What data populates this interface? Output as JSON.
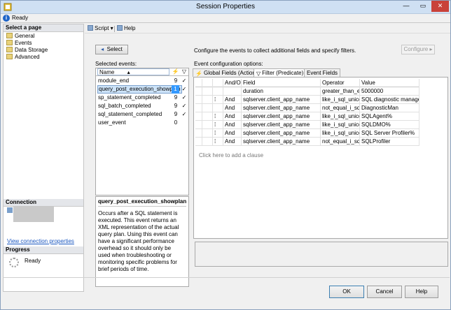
{
  "window": {
    "title": "Session Properties",
    "minimize": "—",
    "maximize": "▭",
    "close": "✕"
  },
  "status_bar": {
    "text": "Ready"
  },
  "left_pane": {
    "select_page_header": "Select a page",
    "pages": [
      "General",
      "Events",
      "Data Storage",
      "Advanced"
    ],
    "connection_header": "Connection",
    "view_connection_link": "View connection properties",
    "progress_header": "Progress",
    "progress_text": "Ready"
  },
  "toolbar": {
    "script_label": "Script",
    "help_label": "Help"
  },
  "select_button": "Select",
  "instruction": "Configure the events to collect additional fields and specify filters.",
  "configure_button": "Configure",
  "selected_events_label": "Selected events:",
  "event_config_label": "Event configuration options:",
  "events_list": {
    "name_header": "Name",
    "count_header": "⚡",
    "check_header": "▽",
    "rows": [
      {
        "name": "module_end",
        "count": "9",
        "check": "✓"
      },
      {
        "name": "query_post_execution_showplan",
        "count": "1",
        "check": "✓"
      },
      {
        "name": "sp_statement_completed",
        "count": "9",
        "check": "✓"
      },
      {
        "name": "sql_batch_completed",
        "count": "9",
        "check": "✓"
      },
      {
        "name": "sql_statement_completed",
        "count": "9",
        "check": "✓"
      },
      {
        "name": "user_event",
        "count": "0",
        "check": ""
      }
    ]
  },
  "description": {
    "title": "query_post_execution_showplan",
    "body": "Occurs after a SQL statement is executed. This event returns an XML representation of the actual query plan. Using this event can have a significant performance overhead so it should only be used when troubleshooting or monitoring specific problems for brief periods of time."
  },
  "tabs": [
    "Global Fields (Actions)",
    "Filter (Predicate)",
    "Event Fields"
  ],
  "filter_grid": {
    "headers": [
      "",
      "",
      "",
      "And/Or",
      "Field",
      "Operator",
      "Value"
    ],
    "rows": [
      {
        "andor": "",
        "field": "duration",
        "operator": "greater_than_e...",
        "value": "5000000"
      },
      {
        "andor": "And",
        "field": "sqlserver.client_app_name",
        "operator": "like_i_sql_unico...",
        "value": "SQL diagnostic manager%"
      },
      {
        "andor": "And",
        "field": "sqlserver.client_app_name",
        "operator": "not_equal_i_sql_...",
        "value": "DiagnosticMan"
      },
      {
        "andor": "And",
        "field": "sqlserver.client_app_name",
        "operator": "like_i_sql_unico...",
        "value": "SQLAgent%"
      },
      {
        "andor": "And",
        "field": "sqlserver.client_app_name",
        "operator": "like_i_sql_unico...",
        "value": "SQLDMO%"
      },
      {
        "andor": "And",
        "field": "sqlserver.client_app_name",
        "operator": "like_i_sql_unico...",
        "value": "SQL Server Profiler%"
      },
      {
        "andor": "And",
        "field": "sqlserver.client_app_name",
        "operator": "not_equal_i_sql_...",
        "value": "SQLProfiler"
      }
    ],
    "add_clause": "Click here to add a clause"
  },
  "buttons": {
    "ok": "OK",
    "cancel": "Cancel",
    "help": "Help"
  }
}
